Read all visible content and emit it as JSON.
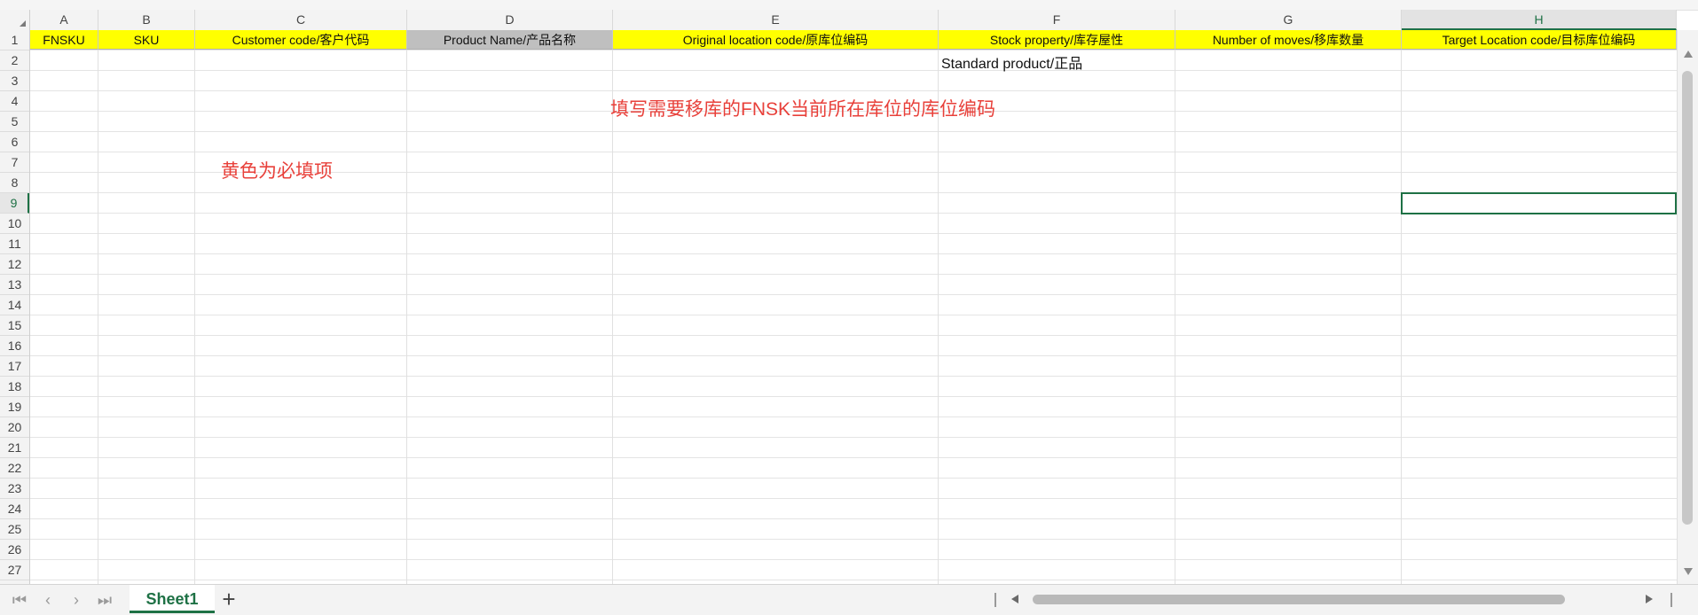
{
  "columns": [
    {
      "letter": "A",
      "header": "FNSKU",
      "fill": "yellow"
    },
    {
      "letter": "B",
      "header": "SKU",
      "fill": "yellow"
    },
    {
      "letter": "C",
      "header": "Customer code/客户代码",
      "fill": "yellow"
    },
    {
      "letter": "D",
      "header": "Product Name/产品名称",
      "fill": "gray"
    },
    {
      "letter": "E",
      "header": "Original location code/原库位编码",
      "fill": "yellow"
    },
    {
      "letter": "F",
      "header": "Stock property/库存屋性",
      "fill": "yellow"
    },
    {
      "letter": "G",
      "header": "Number of moves/移库数量",
      "fill": "yellow"
    },
    {
      "letter": "H",
      "header": "Target Location code/目标库位编码",
      "fill": "yellow"
    }
  ],
  "rows": [
    "1",
    "2",
    "3",
    "4",
    "5",
    "6",
    "7",
    "8",
    "9",
    "10",
    "11",
    "12",
    "13",
    "14",
    "15",
    "16",
    "17",
    "18",
    "19",
    "20",
    "21",
    "22",
    "23",
    "24",
    "25",
    "26",
    "27"
  ],
  "active_column": "H",
  "active_row": "9",
  "cells": {
    "F2": "Standard product/正品"
  },
  "notes": {
    "location_hint": "填写需要移库的FNSK当前所在库位的库位编码",
    "required_hint": "黄色为必填项"
  },
  "sheet_bar": {
    "active_sheet": "Sheet1",
    "add_sheet": "+"
  },
  "colors": {
    "required_fill": "#ffff00",
    "optional_fill": "#bfbfbf",
    "accent": "#1e7145",
    "note_text": "#e8403a"
  }
}
